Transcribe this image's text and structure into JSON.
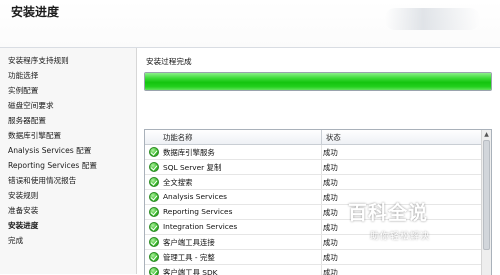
{
  "header": {
    "title": "安装进度"
  },
  "sidebar": {
    "items": [
      {
        "label": "安装程序支持规则"
      },
      {
        "label": "功能选择"
      },
      {
        "label": "实例配置"
      },
      {
        "label": "磁盘空间要求"
      },
      {
        "label": "服务器配置"
      },
      {
        "label": "数据库引擎配置"
      },
      {
        "label": "Analysis Services 配置"
      },
      {
        "label": "Reporting Services 配置"
      },
      {
        "label": "错误和使用情况报告"
      },
      {
        "label": "安装规则"
      },
      {
        "label": "准备安装"
      },
      {
        "label": "安装进度"
      },
      {
        "label": "完成"
      }
    ],
    "active_index": 11
  },
  "main": {
    "status_text": "安装过程完成",
    "progress_fraction": 1.0,
    "table": {
      "columns": [
        "功能名称",
        "状态"
      ],
      "rows": [
        {
          "name": "数据库引擎服务",
          "status": "成功"
        },
        {
          "name": "SQL Server 复制",
          "status": "成功"
        },
        {
          "name": "全文搜索",
          "status": "成功"
        },
        {
          "name": "Analysis Services",
          "status": "成功"
        },
        {
          "name": "Reporting Services",
          "status": "成功"
        },
        {
          "name": "Integration Services",
          "status": "成功"
        },
        {
          "name": "客户端工具连接",
          "status": "成功"
        },
        {
          "name": "管理工具 - 完整",
          "status": "成功"
        },
        {
          "name": "客户端工具 SDK",
          "status": "成功"
        }
      ]
    }
  },
  "watermark": {
    "title": "百科全说",
    "subtitle": "助你轻松解决"
  },
  "icons": {
    "row_icon": "success-check-icon",
    "scroll": "chevron-up-icon"
  },
  "colors": {
    "progress_green": "#14c40f",
    "success_green": "#3fbf2f"
  }
}
